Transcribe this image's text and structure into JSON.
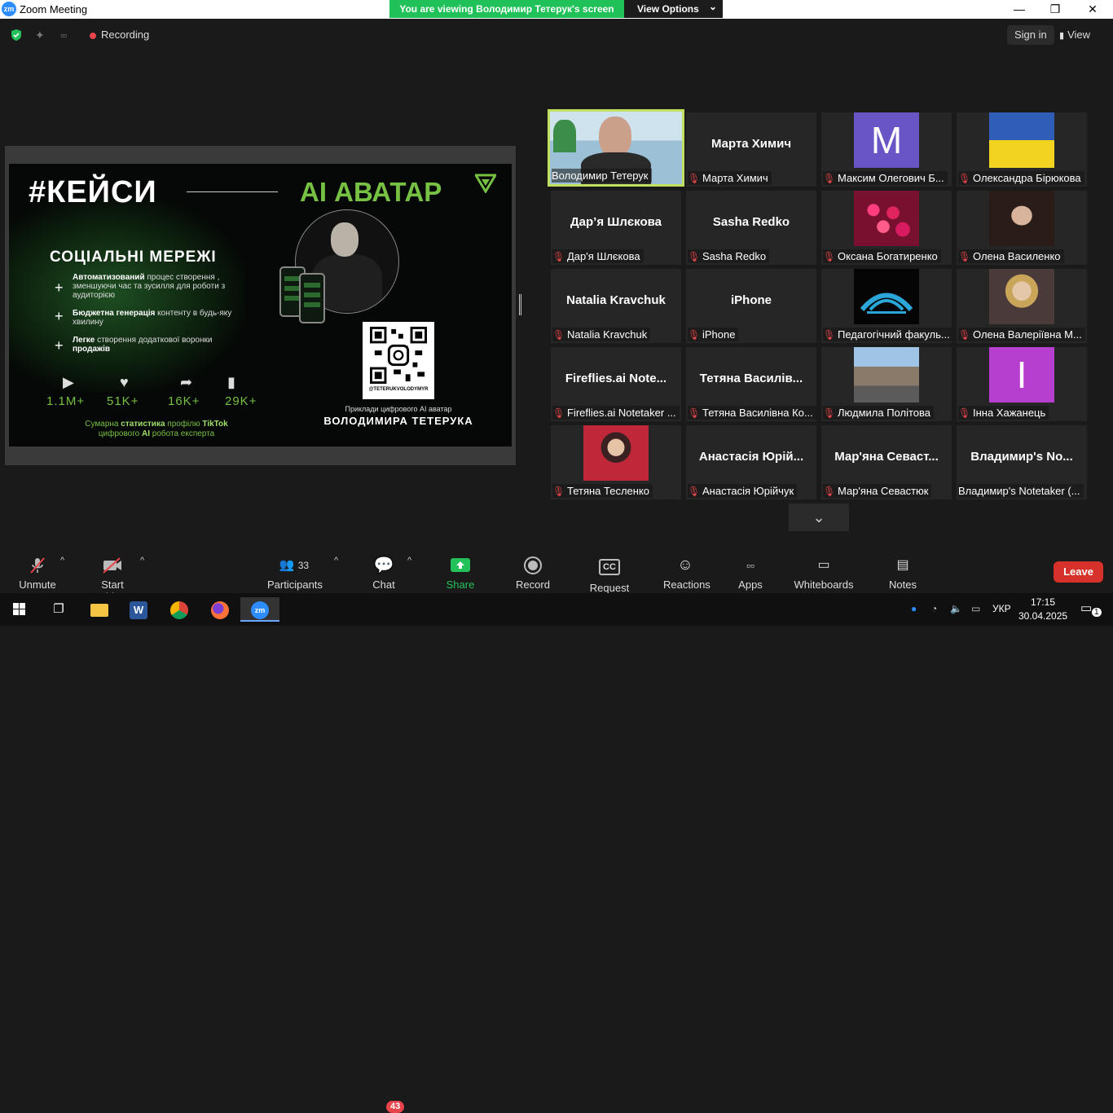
{
  "window": {
    "title": "Zoom Meeting",
    "minimize": "—",
    "maximize": "❐",
    "close": "✕",
    "logo": "zm"
  },
  "banner": {
    "message": "You are viewing Володимир Тетерук's screen",
    "view_options": "View Options",
    "chevron": "⌄"
  },
  "topbar": {
    "recording": "Recording",
    "sign_in": "Sign in",
    "view": "View",
    "view_icon": "▮"
  },
  "slide": {
    "hashtag": "#КЕЙСИ",
    "ai_title": "AI АВАТАР",
    "social_title": "СОЦІАЛЬНІ МЕРЕЖІ",
    "items": [
      {
        "bold": "Автоматизований",
        "text": " процес створення , зменшуючи час та зусилля для роботи з аудиторією"
      },
      {
        "bold": "Бюджетна генерація",
        "text": " контенту в будь-яку хвилину"
      },
      {
        "bold": "Легке",
        "text": " створення додаткової воронки ",
        "bold2": "продажів"
      }
    ],
    "stats": [
      {
        "icon": "play-icon",
        "glyph": "▶",
        "value": "1.1M+"
      },
      {
        "icon": "heart-icon",
        "glyph": "♥",
        "value": "51K+"
      },
      {
        "icon": "share-icon",
        "glyph": "➦",
        "value": "16K+"
      },
      {
        "icon": "bookmark-icon",
        "glyph": "▮",
        "value": "29K+"
      }
    ],
    "summary_1": "Сумарна ",
    "summary_b1": "статистика",
    "summary_2": " профілю ",
    "summary_b2": "TikTok",
    "summary_3": "цифрового ",
    "summary_b3": "AI",
    "summary_4": " робота експерта",
    "qr_handle": "@TETERUKVOLODYMYR",
    "examples": "Приклади цифрового AI аватар",
    "author": "ВОЛОДИМИРА ТЕТЕРУКА",
    "plus": "+"
  },
  "participants": [
    {
      "tile_name": "",
      "label": "Володимир Тетерук",
      "muted": false,
      "active": true,
      "kind": "video"
    },
    {
      "tile_name": "Марта Химич",
      "label": "Марта Химич",
      "muted": true,
      "kind": "name"
    },
    {
      "tile_name": "",
      "label": "Максим Олегович Б...",
      "muted": true,
      "kind": "letter",
      "letter": "M",
      "color": "#6a55c6"
    },
    {
      "tile_name": "",
      "label": "Олександра Бірюкова",
      "muted": true,
      "kind": "flag"
    },
    {
      "tile_name": "Дар’я Шлєкова",
      "label": "Дар'я Шлєкова",
      "muted": true,
      "kind": "name"
    },
    {
      "tile_name": "Sasha Redko",
      "label": "Sasha Redko",
      "muted": true,
      "kind": "name"
    },
    {
      "tile_name": "",
      "label": "Оксана Богатиренко",
      "muted": true,
      "kind": "roses"
    },
    {
      "tile_name": "",
      "label": "Олена  Василенко",
      "muted": true,
      "kind": "portrait_dark"
    },
    {
      "tile_name": "Natalia Kravchuk",
      "label": "Natalia Kravchuk",
      "muted": true,
      "kind": "name"
    },
    {
      "tile_name": "iPhone",
      "label": "iPhone",
      "muted": true,
      "kind": "name"
    },
    {
      "tile_name": "",
      "label": "Педагогічний факуль...",
      "muted": true,
      "kind": "logo_blue"
    },
    {
      "tile_name": "",
      "label": "Олена Валеріївна М...",
      "muted": true,
      "kind": "portrait_blonde"
    },
    {
      "tile_name": "Fireflies.ai  Note...",
      "label": "Fireflies.ai Notetaker ...",
      "muted": true,
      "kind": "name"
    },
    {
      "tile_name": "Тетяна  Василів...",
      "label": "Тетяна Василівна Ко...",
      "muted": true,
      "kind": "name"
    },
    {
      "tile_name": "",
      "label": "Людмила Політова",
      "muted": true,
      "kind": "street"
    },
    {
      "tile_name": "",
      "label": "Інна Хажанець",
      "muted": true,
      "kind": "letter",
      "letter": "I",
      "color": "#b63fcf"
    },
    {
      "tile_name": "",
      "label": "Тетяна Тесленко",
      "muted": true,
      "kind": "portrait_red"
    },
    {
      "tile_name": "Анастасія  Юрій...",
      "label": "Анастасія Юрійчук",
      "muted": true,
      "kind": "name"
    },
    {
      "tile_name": "Мар'яна  Севаст...",
      "label": "Мар'яна Севастюк",
      "muted": true,
      "kind": "name"
    },
    {
      "tile_name": "Владимир's  No...",
      "label": "Владимир's Notetaker (...",
      "muted": false,
      "kind": "name"
    }
  ],
  "pager": {
    "glyph": "⌄"
  },
  "toolbar": {
    "unmute": "Unmute",
    "start_video": "Start Video",
    "participants": "Participants",
    "participants_count": "33",
    "chat": "Chat",
    "chat_badge": "43",
    "share_screen": "Share Screen",
    "record": "Record",
    "request_captions": "Request Captions",
    "reactions": "Reactions",
    "apps": "Apps",
    "whiteboards": "Whiteboards",
    "notes": "Notes",
    "leave": "Leave",
    "caret": "^"
  },
  "taskbar": {
    "language": "УКР",
    "time": "17:15",
    "date": "30.04.2025",
    "notifications": "1"
  },
  "colors": {
    "accent_green": "#23c15a",
    "leave_red": "#d6312a",
    "mute_red": "#e8444a",
    "active_border": "#c2e060",
    "slide_green": "#76c043"
  }
}
